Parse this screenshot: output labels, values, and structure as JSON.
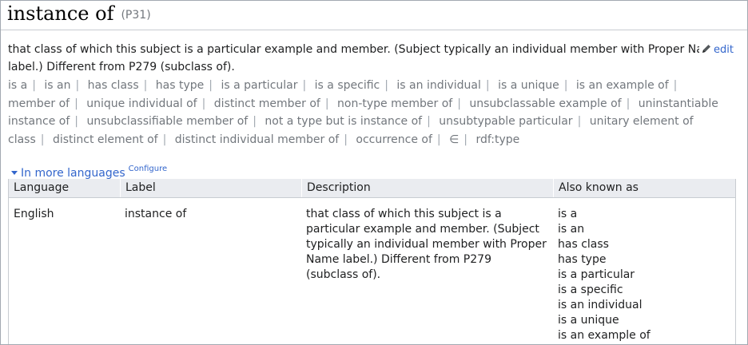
{
  "header": {
    "title": "instance of",
    "property_id": "(P31)"
  },
  "description": {
    "line1": "that class of which this subject is a particular example and member. (Subject typically an individual member with Proper Name",
    "line2": "label.) Different from P279 (subclass of).",
    "edit_label": "edit"
  },
  "aliases": [
    "is a",
    "is an",
    "has class",
    "has type",
    "is a particular",
    "is a specific",
    "is an individual",
    "is a unique",
    "is an example of",
    "member of",
    "unique individual of",
    "distinct member of",
    "non-type member of",
    "unsubclassable example of",
    "uninstantiable instance of",
    "unsubclassifiable member of",
    "not a type but is instance of",
    "unsubtypable particular",
    "unitary element of class",
    "distinct element of",
    "distinct individual member of",
    "occurrence of",
    "∈",
    "rdf:type"
  ],
  "languages": {
    "toggle_label": "In more languages",
    "configure_label": "Configure",
    "columns": {
      "language": "Language",
      "label": "Label",
      "description": "Description",
      "also_known_as": "Also known as"
    },
    "rows": [
      {
        "language": "English",
        "label": "instance of",
        "description": "that class of which this subject is a particular example and member. (Subject typically an individual member with Proper Name label.) Different from P279 (subclass of).",
        "also_known_as": [
          "is a",
          "is an",
          "has class",
          "has type",
          "is a particular",
          "is a specific",
          "is an individual",
          "is a unique",
          "is an example of"
        ]
      }
    ]
  },
  "colors": {
    "link": "#3366cc",
    "muted": "#72777d",
    "table_header_bg": "#eaecf0",
    "border": "#c8ccd1"
  }
}
